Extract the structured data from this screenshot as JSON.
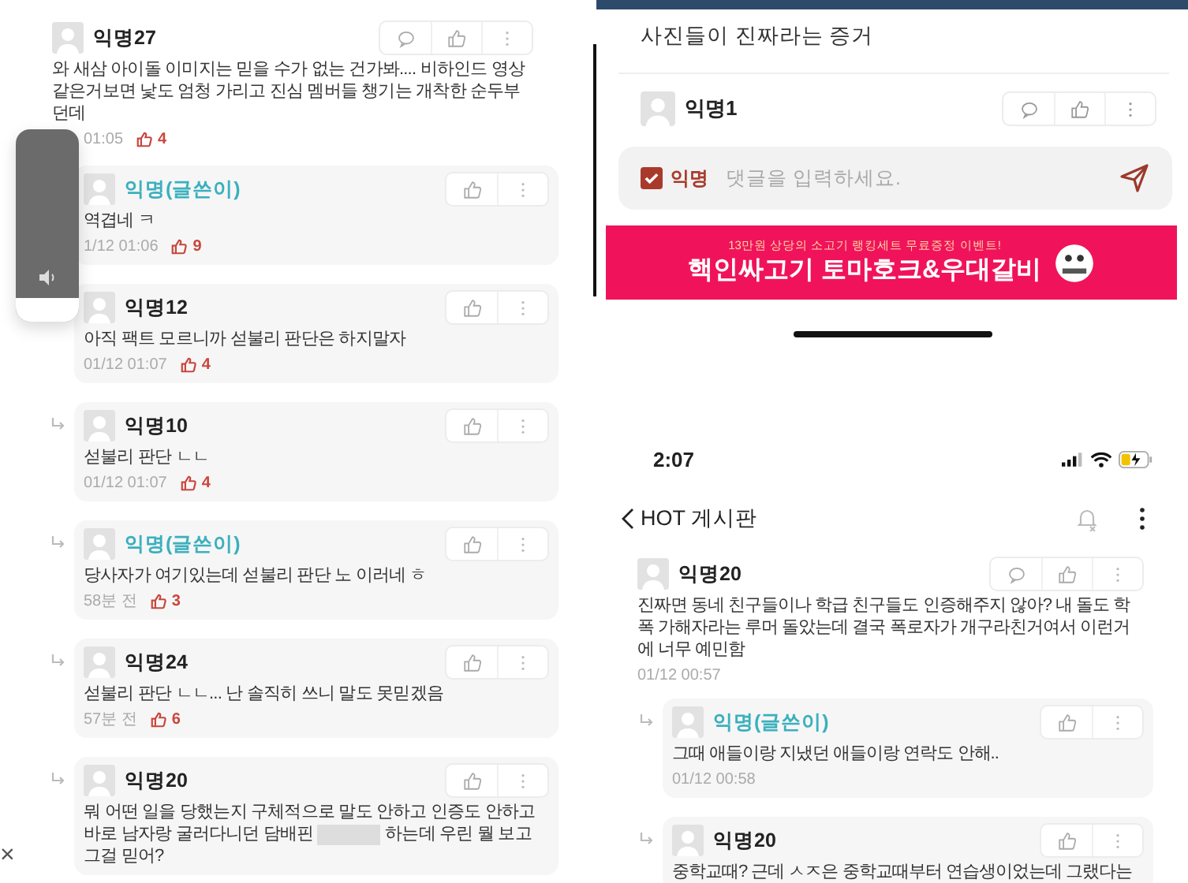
{
  "left_panel": {
    "volume": {
      "level": 0.12
    },
    "comments": [
      {
        "author": "익명27",
        "writer": false,
        "reply": false,
        "body": [
          {
            "kind": "text",
            "text": "와 새삼 아이돌 이미지는 믿을 수가 없는 건가봐.... 비하인드 영상 같은거보면 낯도 엄청 가리고 진심 멤버들 챙기는 개착한 순두부던데"
          }
        ],
        "time": "01:05",
        "likes": "4"
      },
      {
        "author": "익명(글쓴이)",
        "writer": true,
        "reply": true,
        "arrow_shown": false,
        "body": [
          {
            "kind": "text",
            "text": "역겹네 ㅋ"
          }
        ],
        "time": "1/12 01:06",
        "likes": "9"
      },
      {
        "author": "익명12",
        "writer": false,
        "reply": true,
        "arrow_shown": false,
        "body": [
          {
            "kind": "text",
            "text": "아직 팩트 모르니까 섣불리 판단은 하지말자"
          }
        ],
        "time": "01/12 01:07",
        "likes": "4"
      },
      {
        "author": "익명10",
        "writer": false,
        "reply": true,
        "body": [
          {
            "kind": "text",
            "text": "섣불리 판단 ㄴㄴ"
          }
        ],
        "time": "01/12 01:07",
        "likes": "4"
      },
      {
        "author": "익명(글쓴이)",
        "writer": true,
        "reply": true,
        "body": [
          {
            "kind": "text",
            "text": "당사자가 여기있는데 섣불리 판단 노 이러네 ㅎ"
          }
        ],
        "time": "58분 전",
        "likes": "3"
      },
      {
        "author": "익명24",
        "writer": false,
        "reply": true,
        "body": [
          {
            "kind": "text",
            "text": "섣불리 판단 ㄴㄴ... 난 솔직히 쓰니 말도 못믿겠음"
          }
        ],
        "time": "57분 전",
        "likes": "6"
      },
      {
        "author": "익명20",
        "writer": false,
        "reply": true,
        "body": [
          {
            "kind": "text",
            "text": "뭐 어떤 일을 당했는지 구체적으로 말도 안하고 인증도 안하고 바로 남자랑 굴러다니던 담배핀 "
          },
          {
            "kind": "redacted"
          },
          {
            "kind": "text",
            "text": " 하는데 우린 뭘 보고 그걸 믿어?"
          }
        ]
      }
    ],
    "close_label": "×"
  },
  "right_panel": {
    "post_text": "사진들이 진짜라는 증거",
    "top_comment": {
      "author": "익명1"
    },
    "input": {
      "anonymous_label": "익명",
      "anonymous_checked": true,
      "placeholder": "댓글을 입력하세요."
    },
    "banner": {
      "subtitle": "13만원 상당의 소고기 랭킹세트 무료증정 이벤트!",
      "title": "핵인싸고기 토마호크&우대갈비"
    },
    "status_bar": {
      "time": "2:07"
    },
    "header": {
      "title": "HOT 게시판"
    },
    "comments": [
      {
        "author": "익명20",
        "writer": false,
        "reply": false,
        "body": [
          {
            "kind": "text",
            "text": "진짜면 동네 친구들이나 학급 친구들도 인증해주지 않아? 내 돌도 학폭 가해자라는 루머 돌았는데 결국 폭로자가 개구라친거여서 이런거에 너무 예민함"
          }
        ],
        "time": "01/12 00:57"
      },
      {
        "author": "익명(글쓴이)",
        "writer": true,
        "reply": true,
        "body": [
          {
            "kind": "text",
            "text": "그때 애들이랑 지냈던 애들이랑 연락도 안해.."
          }
        ],
        "time": "01/12 00:58"
      },
      {
        "author": "익명20",
        "writer": false,
        "reply": true,
        "body": [
          {
            "kind": "text",
            "text": "중학교때? 근데 ㅅㅈ은 중학교때부터 연습생이었는데 그랬다는"
          }
        ]
      }
    ]
  }
}
